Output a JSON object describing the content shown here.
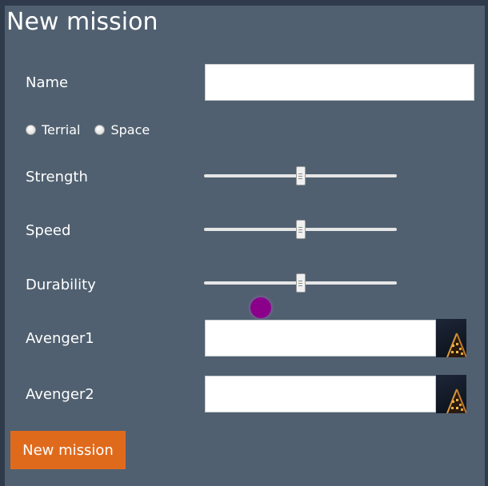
{
  "form": {
    "title": "New mission",
    "name_label": "Name",
    "name_value": "",
    "mission_types": [
      "Terrial",
      "Space"
    ],
    "strength_label": "Strength",
    "strength_value": 0.5,
    "speed_label": "Speed",
    "speed_value": 0.5,
    "durability_label": "Durability",
    "durability_value": 0.5,
    "avenger1_label": "Avenger1",
    "avenger1_value": "",
    "avenger2_label": "Avenger2",
    "avenger2_value": "",
    "submit_label": "New mission"
  },
  "colors": {
    "background": "#2f3b4a",
    "panel": "#506070",
    "button": "#e06a1c",
    "cursor_dot": "#8b008b"
  }
}
